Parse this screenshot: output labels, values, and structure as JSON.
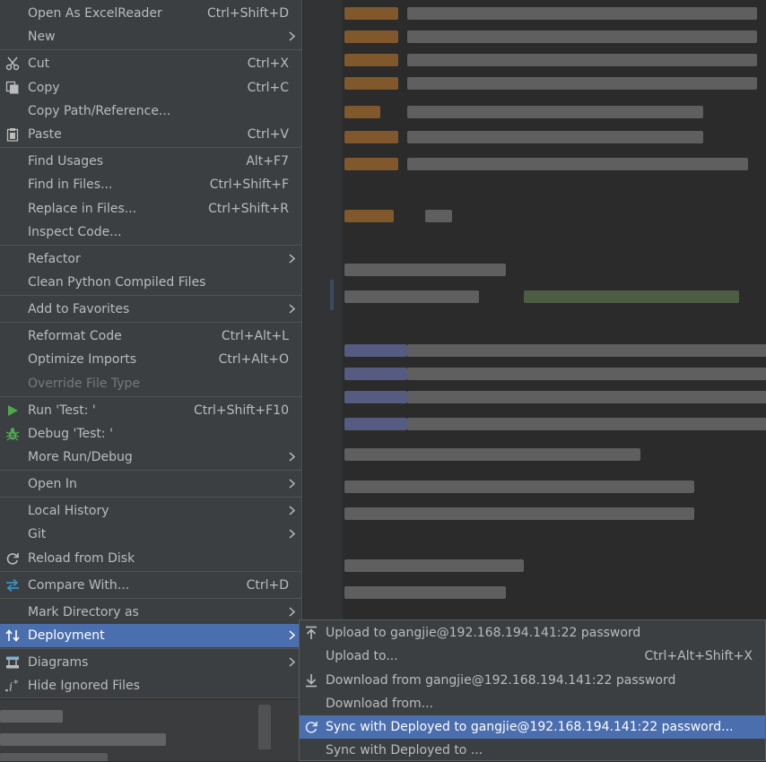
{
  "menu": {
    "items": [
      {
        "label": "Open As ExcelReader",
        "shortcut": "Ctrl+Shift+D"
      },
      {
        "label": "New",
        "shortcut": ""
      },
      {
        "label": "Cut",
        "shortcut": "Ctrl+X",
        "icon": "scissors-icon"
      },
      {
        "label": "Copy",
        "shortcut": "Ctrl+C",
        "icon": "copy-icon"
      },
      {
        "label": "Copy Path/Reference...",
        "shortcut": ""
      },
      {
        "label": "Paste",
        "shortcut": "Ctrl+V",
        "icon": "clipboard-icon"
      },
      {
        "label": "Find Usages",
        "shortcut": "Alt+F7"
      },
      {
        "label": "Find in Files...",
        "shortcut": "Ctrl+Shift+F"
      },
      {
        "label": "Replace in Files...",
        "shortcut": "Ctrl+Shift+R"
      },
      {
        "label": "Inspect Code...",
        "shortcut": ""
      },
      {
        "label": "Refactor",
        "shortcut": ""
      },
      {
        "label": "Clean Python Compiled Files",
        "shortcut": ""
      },
      {
        "label": "Add to Favorites",
        "shortcut": ""
      },
      {
        "label": "Reformat Code",
        "shortcut": "Ctrl+Alt+L"
      },
      {
        "label": "Optimize Imports",
        "shortcut": "Ctrl+Alt+O"
      },
      {
        "label": "Override File Type",
        "shortcut": "",
        "disabled": true
      },
      {
        "label": "Run 'Test: '",
        "shortcut": "Ctrl+Shift+F10",
        "icon": "run-icon"
      },
      {
        "label": "Debug 'Test: '",
        "shortcut": "",
        "icon": "debug-bug-icon"
      },
      {
        "label": "More Run/Debug",
        "shortcut": ""
      },
      {
        "label": "Open In",
        "shortcut": ""
      },
      {
        "label": "Local History",
        "shortcut": ""
      },
      {
        "label": "Git",
        "shortcut": ""
      },
      {
        "label": "Reload from Disk",
        "shortcut": "",
        "icon": "reload-icon"
      },
      {
        "label": "Compare With...",
        "shortcut": "Ctrl+D",
        "icon": "compare-arrows-icon"
      },
      {
        "label": "Mark Directory as",
        "shortcut": ""
      },
      {
        "label": "Deployment",
        "shortcut": "",
        "icon": "deployment-icon",
        "selected": true
      },
      {
        "label": "Diagrams",
        "shortcut": "",
        "icon": "diagrams-icon"
      },
      {
        "label": "Hide Ignored Files",
        "shortcut": "",
        "icon": "ignored-files-icon"
      }
    ]
  },
  "submenu": {
    "items": [
      {
        "label": "Upload to gangjie@192.168.194.141:22 password",
        "shortcut": "",
        "icon": "upload-icon"
      },
      {
        "label": "Upload to...",
        "shortcut": "Ctrl+Alt+Shift+X"
      },
      {
        "label": "Download from gangjie@192.168.194.141:22 password",
        "shortcut": "",
        "icon": "download-icon"
      },
      {
        "label": "Download from...",
        "shortcut": ""
      },
      {
        "label": "Sync with Deployed to gangjie@192.168.194.141:22 password...",
        "shortcut": "",
        "icon": "sync-icon",
        "selected": true
      },
      {
        "label": "Sync with Deployed to ...",
        "shortcut": ""
      }
    ]
  },
  "colors": {
    "menu_bg": "#3c3f41",
    "selection": "#4b6eaf",
    "text": "#bbbbbb",
    "disabled_text": "#787878",
    "editor_bg": "#2b2b2b"
  }
}
